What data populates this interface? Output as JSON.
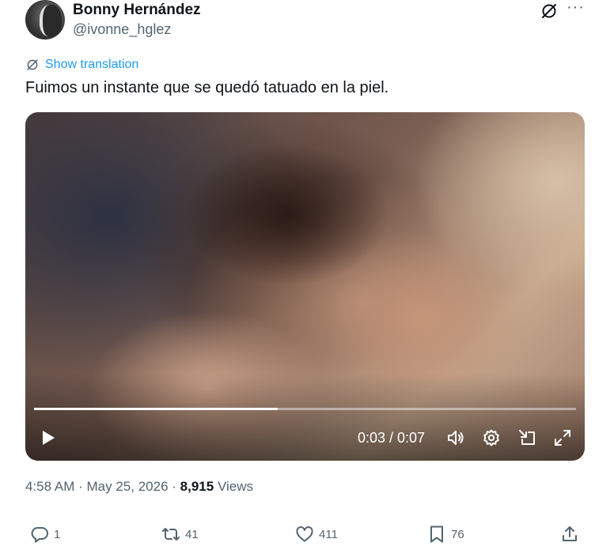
{
  "author": {
    "name": "Bonny Hernández",
    "handle": "@ivonne_hglez",
    "avatar_icon": "profile-photo"
  },
  "header_icons": {
    "grok": "grok-icon",
    "more": "···"
  },
  "translate": {
    "label": "Show translation",
    "icon": "translate-globe-icon"
  },
  "tweet": {
    "text": "Fuimos un instante que se quedó tatuado en la piel."
  },
  "video": {
    "current_time": "0:03",
    "duration": "0:07",
    "time_display": "0:03 / 0:07",
    "progress_fraction": 0.45,
    "controls": [
      "play-icon",
      "volume-icon",
      "settings-icon",
      "dock-icon",
      "fullscreen-icon"
    ]
  },
  "meta": {
    "time": "4:58 AM",
    "date": "May 25, 2026",
    "separator": "·",
    "views_count": "8,915",
    "views_label": "Views"
  },
  "actions": {
    "replies": "1",
    "reposts": "41",
    "likes": "411",
    "bookmarks": "76"
  },
  "colors": {
    "accent": "#1d9bf0",
    "secondary_text": "#536471",
    "primary_text": "#0f1419"
  }
}
